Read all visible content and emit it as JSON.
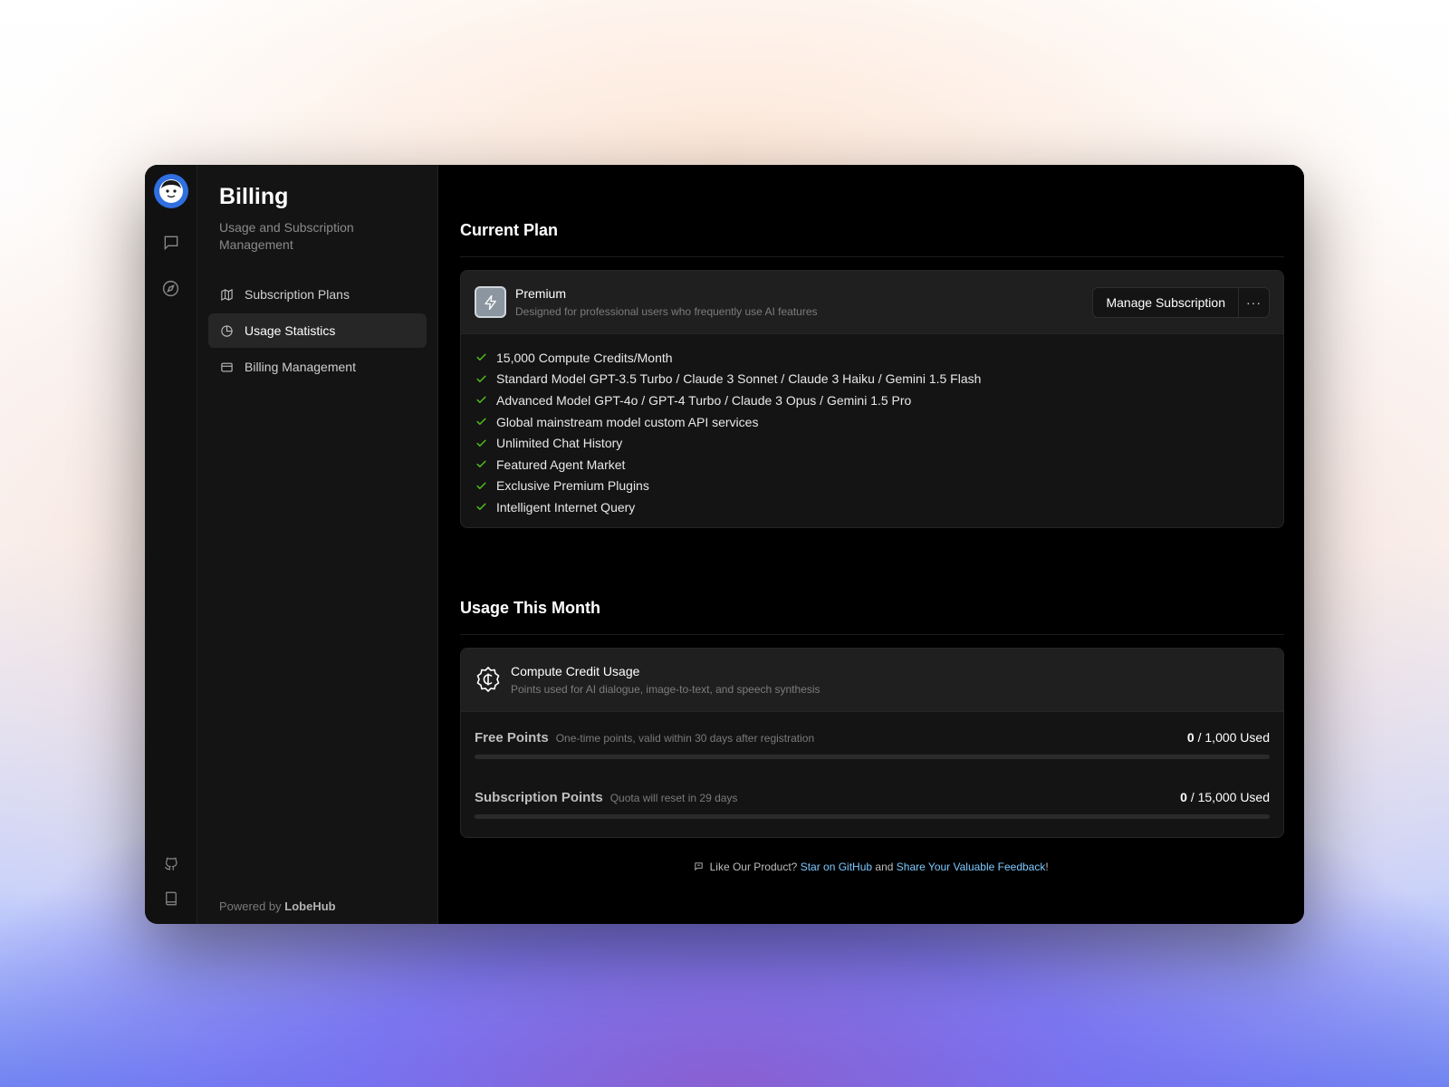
{
  "sidebar": {
    "title": "Billing",
    "subtitle": "Usage and Subscription Management",
    "items": [
      {
        "label": "Subscription Plans",
        "icon": "map-icon",
        "active": false
      },
      {
        "label": "Usage Statistics",
        "icon": "pie-chart-icon",
        "active": true
      },
      {
        "label": "Billing Management",
        "icon": "credit-card-icon",
        "active": false
      }
    ],
    "powered_prefix": "Powered by",
    "powered_brand": "LobeHub"
  },
  "rail": {
    "icons": [
      "avatar",
      "chat-icon",
      "compass-icon",
      "github-icon",
      "book-icon"
    ]
  },
  "current_plan": {
    "section_title": "Current Plan",
    "plan_name": "Premium",
    "plan_desc": "Designed for professional users who frequently use AI features",
    "manage_label": "Manage Subscription",
    "more_label": "···",
    "features": [
      "15,000 Compute Credits/Month",
      "Standard Model GPT-3.5 Turbo / Claude 3 Sonnet / Claude 3 Haiku / Gemini 1.5 Flash",
      "Advanced Model GPT-4o / GPT-4 Turbo / Claude 3 Opus / Gemini 1.5 Pro",
      "Global mainstream model custom API services",
      "Unlimited Chat History",
      "Featured Agent Market",
      "Exclusive Premium Plugins",
      "Intelligent Internet Query"
    ]
  },
  "usage": {
    "section_title": "Usage This Month",
    "card_title": "Compute Credit Usage",
    "card_desc": "Points used for AI dialogue, image-to-text, and speech synthesis",
    "rows": [
      {
        "label": "Free Points",
        "hint": "One-time points, valid within 30 days after registration",
        "used": "0",
        "total_text": " / 1,000 Used",
        "fraction": 0
      },
      {
        "label": "Subscription Points",
        "hint": "Quota will reset in 29 days",
        "used": "0",
        "total_text": " / 15,000 Used",
        "fraction": 0
      }
    ]
  },
  "footer": {
    "prefix": "Like Our Product?",
    "link1": "Star on GitHub",
    "middle": "and",
    "link2": "Share Your Valuable Feedback",
    "suffix": "!"
  },
  "colors": {
    "accent_check": "#52c41a",
    "link": "#7ec8ff",
    "avatar_bg": "#2f6fe0"
  }
}
